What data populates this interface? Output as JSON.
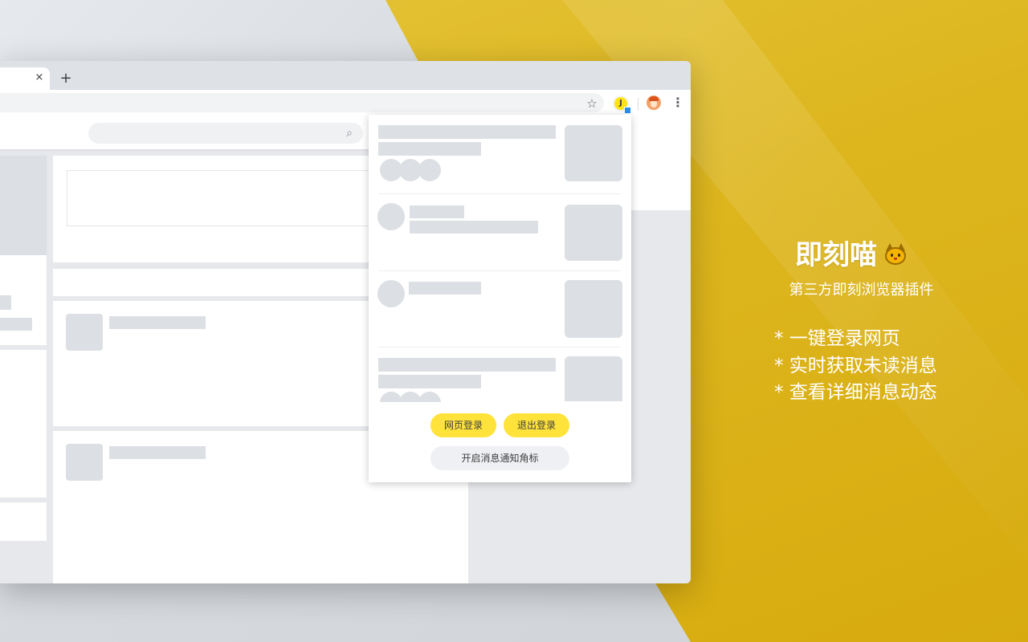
{
  "browser": {
    "tab_close": "×",
    "new_tab": "+",
    "star_icon": "☆",
    "extension_letter": "J",
    "menu_icon": "⋮",
    "search_icon": "⌕"
  },
  "popup": {
    "login_web": "网页登录",
    "logout": "退出登录",
    "enable_badge": "开启消息通知角标"
  },
  "promo": {
    "title": "即刻喵",
    "subtitle": "第三方即刻浏览器插件",
    "features": [
      "* 一键登录网页",
      "* 实时获取未读消息",
      "* 查看详细消息动态"
    ]
  },
  "colors": {
    "accent_yellow": "#ffe33a",
    "background_yellow": "#ddb61e",
    "badge_blue": "#2d8cf0"
  }
}
